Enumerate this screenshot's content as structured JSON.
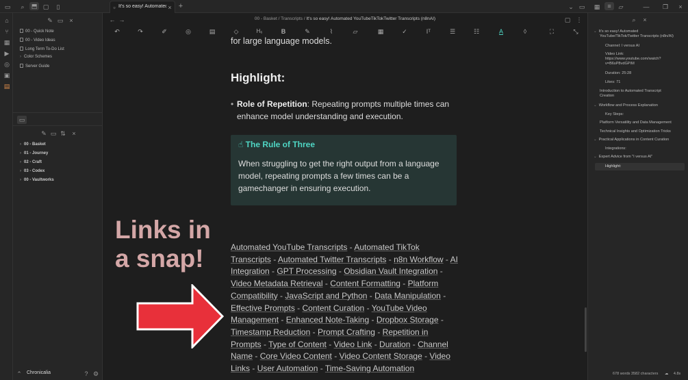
{
  "tab": {
    "title": "It's so easy! Automated..."
  },
  "breadcrumb": {
    "part1": "00 - Basket",
    "sep": "/",
    "part2": "Transcripts",
    "current": "It's so easy! Automated YouTubeTikTokTwitter Transcripts (n8nAI)"
  },
  "sidebar": {
    "files": [
      "00 - Quick Note",
      "00 - Video Ideas",
      "Long Term To-Do List",
      "Color Schemes",
      "Server Guide"
    ],
    "vaults": [
      "00 - Basket",
      "01 - Journey",
      "02 - Craft",
      "03 - Codex",
      "00 - Vaultworks"
    ],
    "vault_name": "Chronicalia"
  },
  "editor": {
    "top_text": "for large language models.",
    "heading": "Highlight:",
    "bullet_bold": "Role of Repetition",
    "bullet_text": ": Repeating prompts multiple times can enhance model understanding and execution.",
    "callout_title": "The Rule of Three",
    "callout_body": "When struggling to get the right output from a language model, repeating prompts a few times can be a gamechanger in ensuring execution.",
    "overlay_line1": "Links in",
    "overlay_line2": "a snap!",
    "links": [
      "Automated YouTube Transcripts",
      "Automated TikTok Transcripts",
      "Automated Twitter Transcripts",
      "n8n Workflow",
      "AI Integration",
      "GPT Processing",
      "Obsidian Vault Integration",
      "Video Metadata Retrieval",
      "Content Formatting",
      "Platform Compatibility",
      "JavaScript and Python",
      "Data Manipulation",
      "Effective Prompts",
      "Content Curation",
      "YouTube Video Management",
      "Enhanced Note-Taking",
      "Dropbox Storage",
      "Timestamp Reduction",
      "Prompt Crafting",
      "Repetition in Prompts",
      "Type of Content",
      "Video Link",
      "Duration",
      "Channel Name",
      "Core Video Content",
      "Video Content Storage",
      "Video Links",
      "User Automation",
      "Time-Saving Automation"
    ],
    "link_separator": " - "
  },
  "outline": {
    "title1": "It's so easy! Automated",
    "title2": "YouTube/TikTok/Twitter Transcripts (n8n/AI)",
    "channel": "Channel: I versus AI",
    "video_link1": "Video Link:",
    "video_link2": "https://www.youtube.com/watch?",
    "video_link3": "v=B6sP8vdGPIM",
    "duration": "Duration: 25:28",
    "likes": "Likes: 71",
    "intro1": "Introduction to Automated Transcript",
    "intro2": "Creation",
    "workflow": "Workflow and Process Explanation",
    "key_steps": "Key Steps:",
    "platform": "Platform Versatility and Data Management",
    "technical": "Technical Insights and Optimization Tricks",
    "practical": "Practical Applications in Content Curation",
    "integrations": "Integrations:",
    "expert": "Expert Advice from \"I versus AI\"",
    "highlight": "Highlight:"
  },
  "status": {
    "counts": "678 words 3582 characters",
    "other": "4.8s"
  }
}
